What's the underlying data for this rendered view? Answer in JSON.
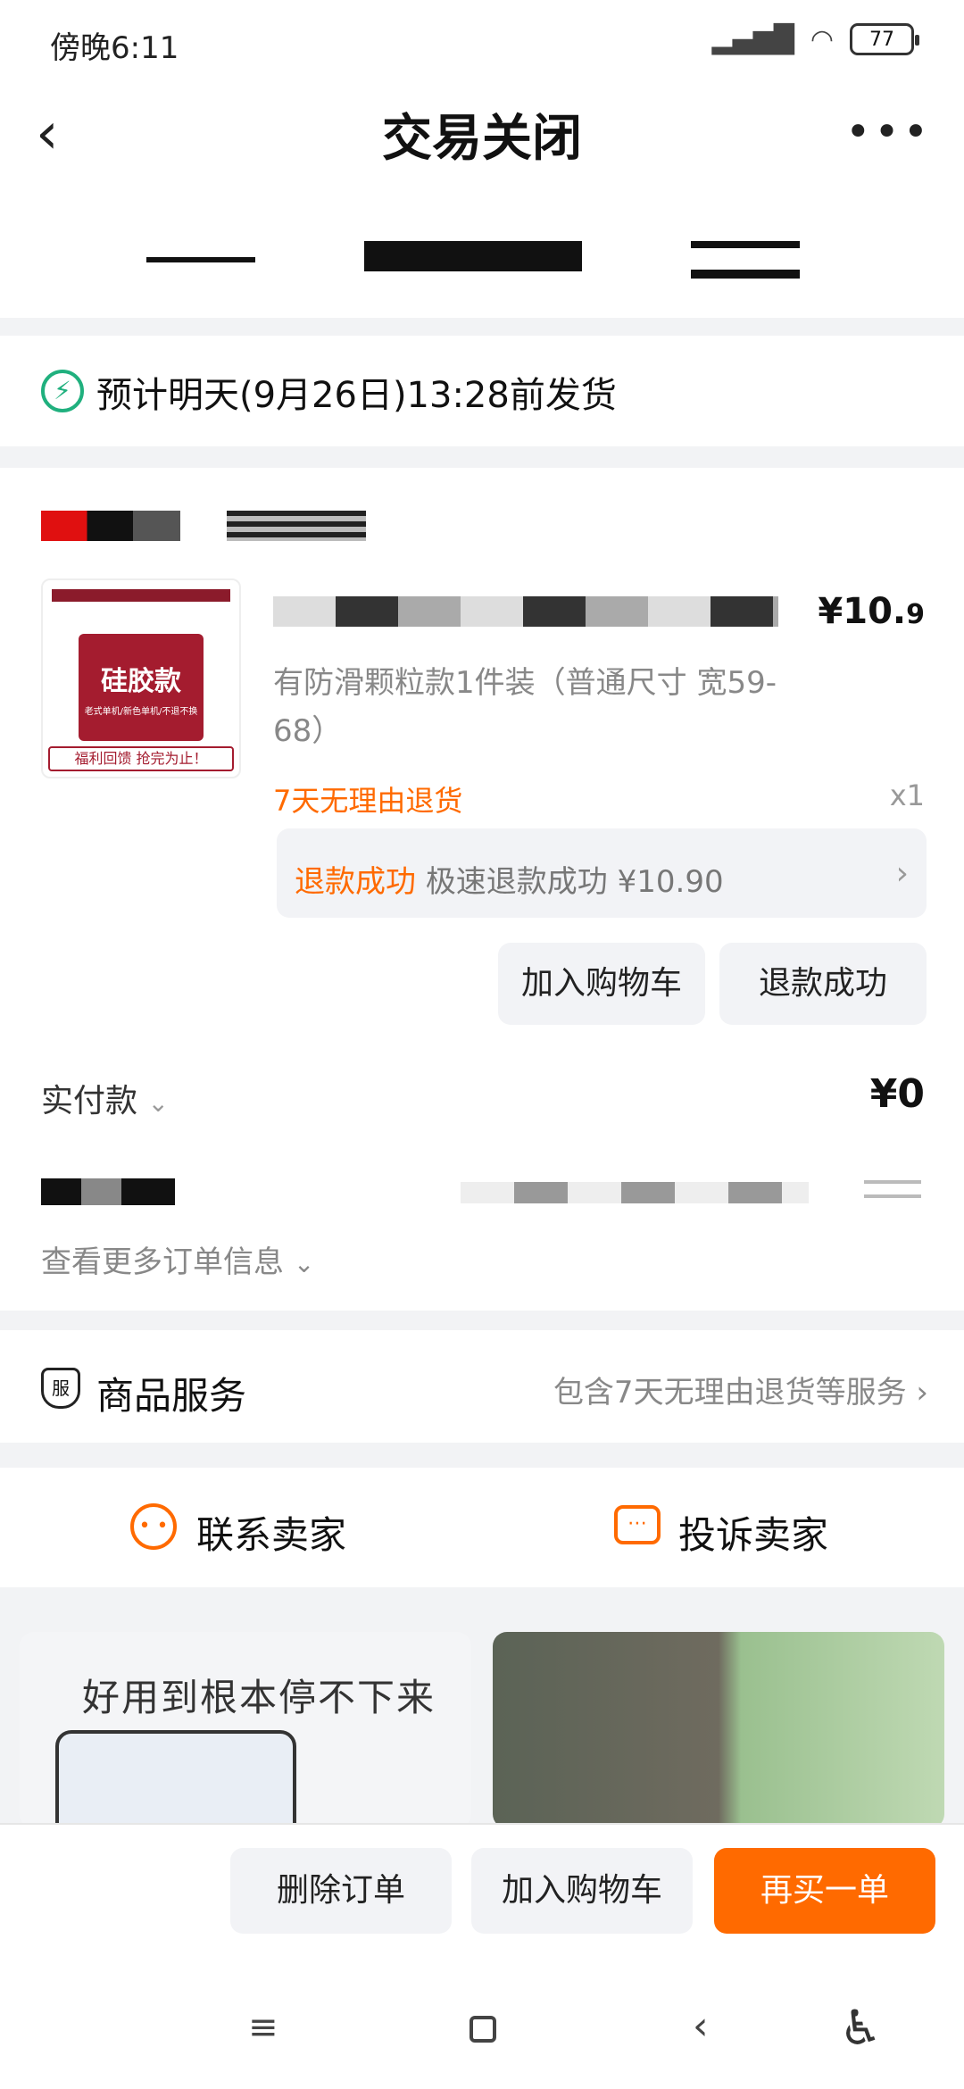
{
  "status_bar": {
    "time": "傍晚6:11",
    "battery": "77"
  },
  "header": {
    "title": "交易关闭",
    "back_label": "‹",
    "more_label": "•••"
  },
  "shipping": {
    "text": "预计明天(9月26日)13:28前发货",
    "icon_glyph": "⚡"
  },
  "product": {
    "thumb_main": "硅胶款",
    "thumb_sub": "老式单机/新色单机/不退不换",
    "thumb_banner": "福利回馈 抢完为止！",
    "price_main": "¥10.",
    "price_decimal": "9",
    "spec": "有防滑颗粒款1件装（普通尺寸 宽59-68）",
    "return_policy": "7天无理由退货",
    "quantity": "x1",
    "refund_status": "退款成功",
    "refund_detail": "极速退款成功 ¥10.90",
    "btn_add_cart": "加入购物车",
    "btn_refund": "退款成功"
  },
  "payment": {
    "label": "实付款",
    "value": "¥0"
  },
  "more_info": "查看更多订单信息",
  "service": {
    "label": "商品服务",
    "icon_text": "服",
    "info": "包含7天无理由退货等服务"
  },
  "contact": {
    "seller": "联系卖家",
    "complain": "投诉卖家"
  },
  "recommend": {
    "card1_text": "好用到根本停不下来"
  },
  "bottom_bar": {
    "delete": "删除订单",
    "add_cart": "加入购物车",
    "rebuy": "再买一单"
  },
  "colors": {
    "accent": "#ff6a00",
    "green": "#20b07e"
  },
  "nav_bar": {
    "menu": "≡",
    "back": "‹",
    "accessibility": "♿"
  }
}
